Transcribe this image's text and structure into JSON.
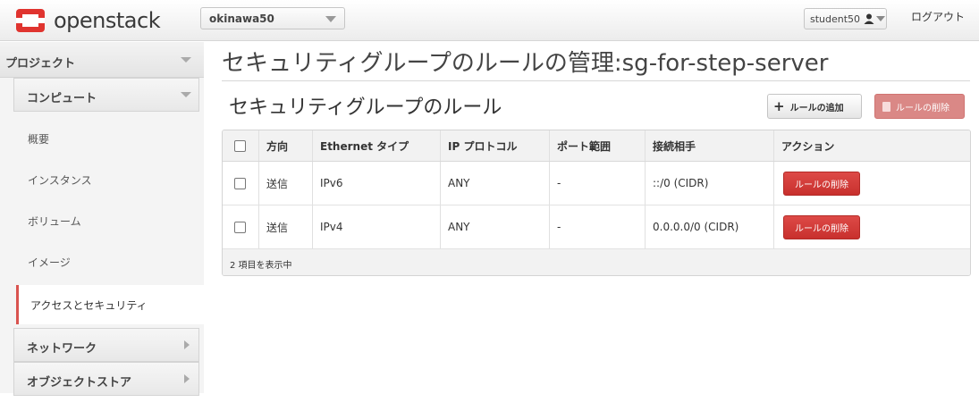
{
  "header": {
    "brand": "openstack",
    "project_selector": "okinawa50",
    "user": "student50",
    "logout": "ログアウト"
  },
  "sidebar": {
    "project_label": "プロジェクト",
    "compute_label": "コンピュート",
    "items": [
      {
        "label": "概要"
      },
      {
        "label": "インスタンス"
      },
      {
        "label": "ボリューム"
      },
      {
        "label": "イメージ"
      },
      {
        "label": "アクセスとセキュリティ"
      }
    ],
    "network_label": "ネットワーク",
    "object_store_label": "オブジェクトストア"
  },
  "page": {
    "title": "セキュリティグループのルールの管理:sg-for-step-server",
    "section_title": "セキュリティグループのルール",
    "add_rule_button": "ルールの追加",
    "delete_rules_button": "ルールの削除"
  },
  "table": {
    "columns": [
      "方向",
      "Ethernet タイプ",
      "IP プロトコル",
      "ポート範囲",
      "接続相手",
      "アクション"
    ],
    "rows": [
      {
        "direction": "送信",
        "ether_type": "IPv6",
        "protocol": "ANY",
        "port_range": "-",
        "remote": "::/0 (CIDR)",
        "action": "ルールの削除"
      },
      {
        "direction": "送信",
        "ether_type": "IPv4",
        "protocol": "ANY",
        "port_range": "-",
        "remote": "0.0.0.0/0 (CIDR)",
        "action": "ルールの削除"
      }
    ],
    "footer": "2 項目を表示中"
  },
  "colors": {
    "brand_red": "#d9534f",
    "danger_button": "#c8302d"
  }
}
